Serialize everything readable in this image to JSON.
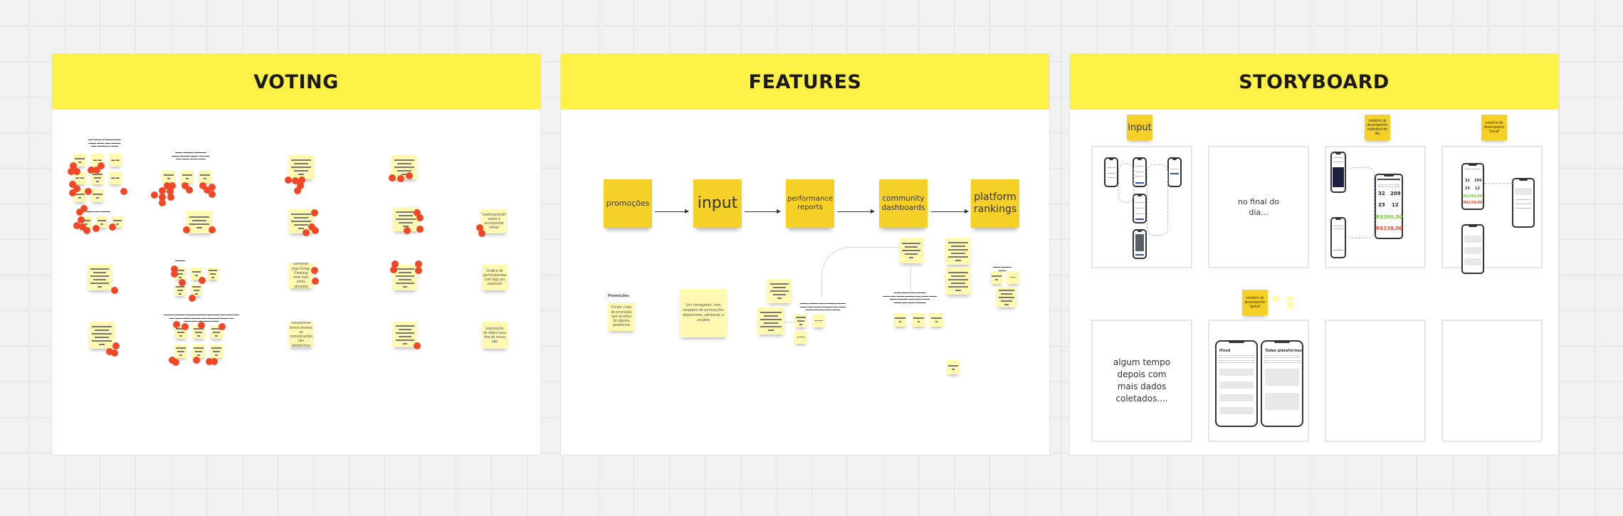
{
  "board": {
    "frames": [
      {
        "id": "voting",
        "title": "VOTING"
      },
      {
        "id": "features",
        "title": "FEATURES"
      },
      {
        "id": "storyboard",
        "title": "STORYBOARD"
      }
    ]
  },
  "colors": {
    "frame_header": "#fef145",
    "sticky_light": "#fff9b1",
    "sticky_yellow": "#f5d128",
    "vote_dot": "#f24726",
    "canvas": "#f1f1f1"
  },
  "voting": {
    "sticky_texts": [
      "\"melhoramento\" salvar e acompanhar metas",
      "Lembrete: jogo Gringo Pleasing todo mês estou atrasada",
      "Gráfico de ganhos/perdas com tags pra organizar",
      "Visualmente temos mostrar as comunicações das plataformas",
      "Exportação de dados para fora do nosso app"
    ]
  },
  "features": {
    "flow": [
      {
        "label": "promoções",
        "size": "small"
      },
      {
        "label": "input",
        "size": "large"
      },
      {
        "label": "performance reports",
        "size": "small"
      },
      {
        "label": "community dashboards",
        "size": "small"
      },
      {
        "label": "platform rankings",
        "size": "medium"
      }
    ],
    "promo_heading": "Promoções",
    "promo_sticky": "Contar o tipo de promoção que recebeu de alguma plataforma",
    "big_sticky": "Um navegador, com resgates de promoções disponíveis, alertando o usuário"
  },
  "storyboard": {
    "tags": {
      "input": "input",
      "individual": "relatório de desempenho individual do dia",
      "social": "relatório de desempenho \"social\"",
      "global": "relatório de desempenho \"global\""
    },
    "cards": {
      "end_of_day": "no final do dia...",
      "later": "algum tempo depois com mais dados coletados...."
    },
    "phone_report": {
      "stats": [
        "32",
        "209",
        "23",
        "12"
      ],
      "earnings": "R$390,00",
      "costs": "R$130,00",
      "earnings_color": "#7ac943",
      "costs_color": "#f24726"
    },
    "phone_global": {
      "left_title": "iFood",
      "right_title": "Todas plataformas"
    }
  }
}
